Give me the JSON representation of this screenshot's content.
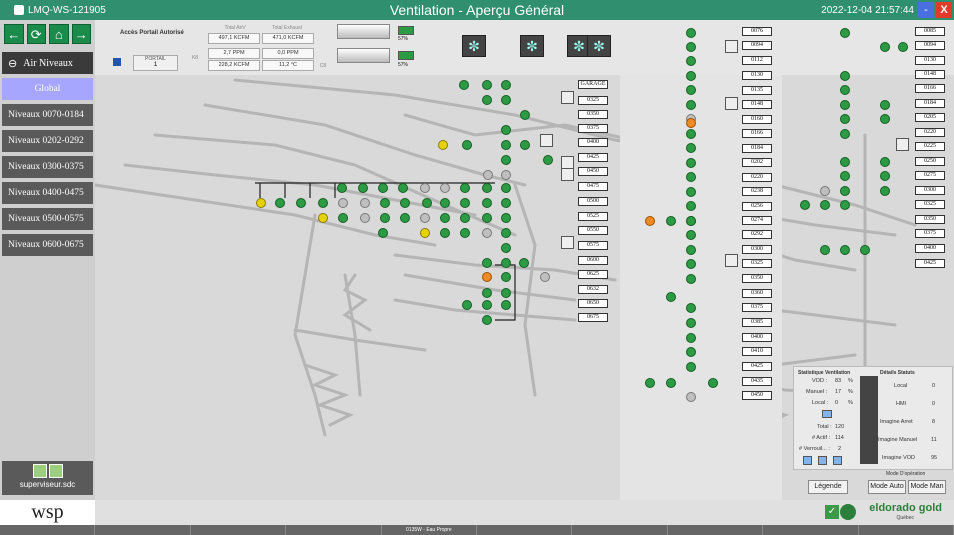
{
  "title": {
    "ws": "LMQ-WS-121905",
    "title": "Ventilation - Aperçu Général",
    "datetime": "2022-12-04 21:57:44",
    "minimize": "-",
    "close": "X"
  },
  "sidebar": {
    "nav_icons": [
      "back-arrow-icon",
      "refresh-icon",
      "home-icon",
      "forward-arrow-icon"
    ],
    "air_niveaux": "Air Niveaux",
    "items": [
      "Global",
      "Niveaux 0070-0184",
      "Niveaux 0202-0292",
      "Niveaux 0300-0375",
      "Niveaux 0400-0475",
      "Niveaux 0500-0575",
      "Niveaux 0600-0675"
    ],
    "user": "superviseur.sdc"
  },
  "top": {
    "acces": "Accès Portail Autorisé",
    "portal_label": "PORTAIL",
    "portal_value": "1",
    "total_airv_label": "Total AirV",
    "total_airv": "497,1 KCFM",
    "total_exhaust_label": "Total Exhaust",
    "total_exhaust": "471,0 KCFM",
    "k8": "K8",
    "ppm1": "2,7 PPM",
    "ppm2": "0,0 PPM",
    "kcfm": "228,2 KCFM",
    "temp": "11,2 °C",
    "c8": "C8",
    "fan_pct1": "57%",
    "fan_pct2": "57%"
  },
  "levels_mid": [
    "GARAGE",
    "0325",
    "0350",
    "0375",
    "0400",
    "0425",
    "0450",
    "0475",
    "0500",
    "0525",
    "0550",
    "0575",
    "0600",
    "0625",
    "0632",
    "0650",
    "0675"
  ],
  "levels_right": [
    "0076",
    "0094",
    "0112",
    "0130",
    "0135",
    "0148",
    "0160",
    "0166",
    "0184",
    "0202",
    "0220",
    "0238",
    "0256",
    "0274",
    "0292",
    "0300",
    "0325",
    "0350",
    "0360",
    "0375",
    "0385",
    "0400",
    "0410",
    "0425",
    "0435",
    "0450"
  ],
  "levels_far": [
    "0085",
    "0094",
    "0130",
    "0148",
    "0166",
    "0184",
    "0205",
    "0220",
    "0225",
    "0250",
    "0275",
    "0300",
    "0325",
    "0350",
    "0375",
    "0400",
    "0425"
  ],
  "stats": {
    "title": "Statistique Ventilation",
    "vod_label": "VOD :",
    "vod": "83",
    "manuel_label": "Manuel :",
    "manuel": "17",
    "local_label": "Local :",
    "local": "0",
    "pct": "%",
    "total_label": "Total :",
    "total": "120",
    "actif_label": "# Actif :",
    "actif": "114",
    "verrou_label": "# Verrouil... :",
    "verrou": "2"
  },
  "details": {
    "title": "Détails Statuts",
    "rows": [
      {
        "label": "Local",
        "value": "0"
      },
      {
        "label": "HMI",
        "value": "0"
      },
      {
        "label": "Imagine Arret",
        "value": "8"
      },
      {
        "label": "Imagine Manuel",
        "value": "11"
      },
      {
        "label": "Imagine VOD",
        "value": "95"
      }
    ]
  },
  "mode": {
    "label": "Mode D'opération",
    "auto": "Mode Auto",
    "man": "Mode Man"
  },
  "legend_btn": "Légende",
  "bottom": {
    "wsp": "wsp",
    "brand": "eldorado gold",
    "brand_sub": "Québec",
    "status_mid": "0135W - Eau Propre"
  },
  "colors": {
    "titlebar": "#2f8f6f",
    "fan_on": "#2d9b43",
    "fan_off": "#bfbfbf",
    "fan_warn": "#e6d200",
    "fan_alarm": "#f08a24",
    "side_active": "#a6a6ff",
    "close": "#e23a2a",
    "minimize": "#4a6fe0"
  }
}
